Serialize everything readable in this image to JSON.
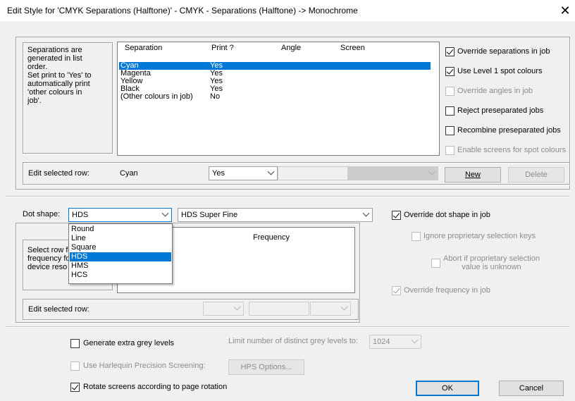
{
  "window": {
    "title": "Edit Style for 'CMYK Separations (Halftone)' - CMYK - Separations (Halftone) -> Monochrome",
    "close_glyph": "✕"
  },
  "separations": {
    "help_text": "Separations are\ngenerated in list\norder.\nSet print to 'Yes' to\nautomatically print\n'other colours in\njob'.",
    "columns": [
      "Separation",
      "Print ?",
      "Angle",
      "Screen"
    ],
    "rows": [
      {
        "separation": "Cyan",
        "print": "Yes",
        "angle": "",
        "screen": "",
        "selected": true
      },
      {
        "separation": "Magenta",
        "print": "Yes",
        "angle": "",
        "screen": "",
        "selected": false
      },
      {
        "separation": "Yellow",
        "print": "Yes",
        "angle": "",
        "screen": "",
        "selected": false
      },
      {
        "separation": "Black",
        "print": "Yes",
        "angle": "",
        "screen": "",
        "selected": false
      },
      {
        "separation": "(Other colours in job)",
        "print": "No",
        "angle": "",
        "screen": "",
        "selected": false
      }
    ],
    "edit_label": "Edit selected row:",
    "edit_value": "Cyan",
    "print_value": "Yes",
    "angle_value": "",
    "screen_value": "",
    "new_label": "New",
    "delete_label": "Delete",
    "options": [
      {
        "label": "Override separations in job",
        "checked": true,
        "enabled": true
      },
      {
        "label": "Use Level 1 spot colours",
        "checked": true,
        "enabled": true
      },
      {
        "label": "Override angles in job",
        "checked": false,
        "enabled": false
      },
      {
        "label": "Reject preseparated jobs",
        "checked": false,
        "enabled": true
      },
      {
        "label": "Recombine preseparated jobs",
        "checked": false,
        "enabled": true
      },
      {
        "label": "Enable screens for spot colours",
        "checked": false,
        "enabled": false
      }
    ]
  },
  "dot": {
    "label": "Dot shape:",
    "shape_value": "HDS",
    "variant_value": "HDS Super Fine",
    "dropdown_options": [
      "Round",
      "Line",
      "Square",
      "HDS",
      "HMS",
      "HCS"
    ],
    "dropdown_selected": "HDS",
    "help_text": "Select row f\nfrequency fo\ndevice reso",
    "freq_column": "Frequency",
    "edit_label": "Edit selected row:",
    "options": [
      {
        "label": "Override dot shape in job",
        "checked": true,
        "enabled": true
      },
      {
        "label": "Ignore proprietary selection keys",
        "checked": false,
        "enabled": false
      },
      {
        "label": "Abort if proprietary selection\nvalue is unknown",
        "checked": false,
        "enabled": false
      },
      {
        "label": "Override frequency in job",
        "checked": true,
        "enabled": false
      }
    ]
  },
  "bottom": {
    "generate_label": "Generate extra grey levels",
    "generate_checked": false,
    "limit_label": "Limit number of distinct grey levels to:",
    "limit_value": "1024",
    "harlequin_label": "Use Harlequin Precision Screening:",
    "harlequin_checked": false,
    "hps_label": "HPS Options...",
    "rotate_label": "Rotate screens according to page rotation",
    "rotate_checked": true,
    "ok_label": "OK",
    "cancel_label": "Cancel"
  },
  "colors": {
    "selection": "#0078d7",
    "window_bg": "#f0f0f0",
    "disabled_text": "#8c8c8c"
  }
}
